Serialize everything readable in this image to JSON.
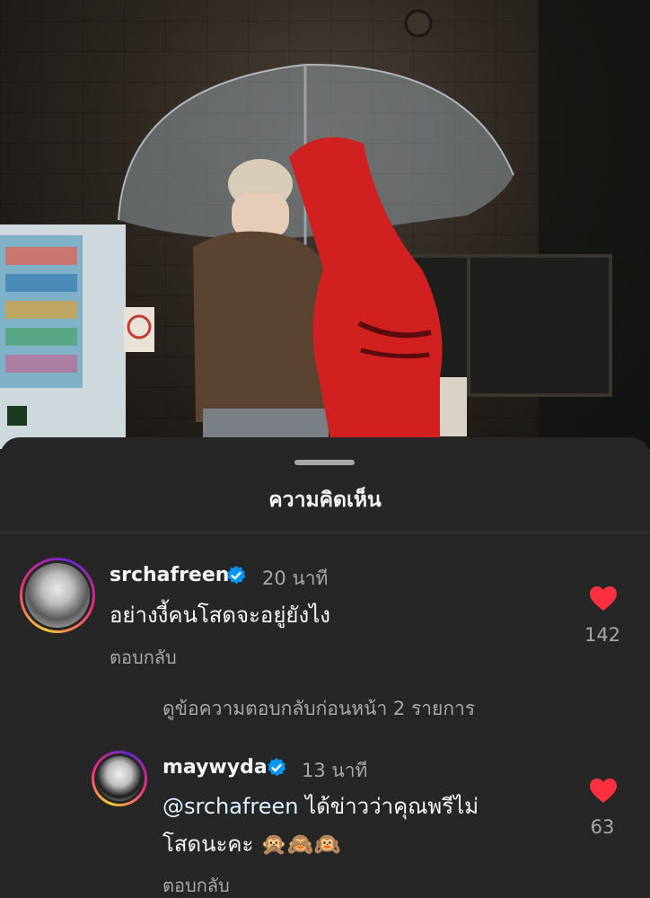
{
  "sheet": {
    "title": "ความคิดเห็น"
  },
  "comments": [
    {
      "username": "srchafreen",
      "verified": true,
      "time": "20 นาที",
      "text": "อย่างงี้คนโสดจะอยู่ยังไง",
      "reply_label": "ตอบกลับ",
      "likes": "142",
      "like_color": "#ff3040"
    },
    {
      "username": "maywyda",
      "verified": true,
      "time": "13 นาที",
      "mention": "@srchafreen",
      "text_line1": " ได้ข่าวว่าคุณพรีไม่",
      "text_line2": "โสดนะคะ ",
      "emojis": "🙊🙈🙉",
      "reply_label": "ตอบกลับ",
      "likes": "63",
      "like_color": "#ff3040"
    }
  ],
  "view_previous_replies": "ดูข้อความตอบกลับก่อนหน้า 2 รายการ",
  "icons": {
    "verified": "verified-badge-icon",
    "like": "heart-icon"
  },
  "colors": {
    "background": "#262626",
    "verified": "#0095f6",
    "heart": "#ff3040"
  }
}
